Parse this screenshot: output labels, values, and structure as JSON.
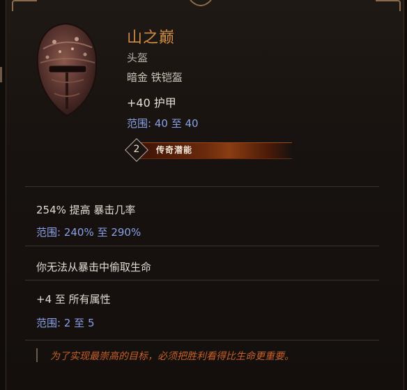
{
  "item": {
    "name": "山之巅",
    "type": "头盔",
    "rarity_type": "暗金 铁铠盔",
    "armor": "+40 护甲",
    "armor_range": {
      "label": "范围",
      "min": "40",
      "sep": "至",
      "max": "40"
    },
    "legendary_badge": {
      "rank": "2",
      "label": "传奇潜能"
    }
  },
  "affixes": [
    {
      "text": "254% 提高 暴击几率",
      "range": {
        "label": "范围",
        "min": "240%",
        "sep": "至",
        "max": "290%"
      }
    },
    {
      "text": "你无法从暴击中偷取生命"
    },
    {
      "text": "+4 至 所有属性",
      "range": {
        "label": "范围",
        "min": "2",
        "sep": "至",
        "max": "5"
      }
    }
  ],
  "flavor_text": "为了实现最崇高的目标，必须把胜利看得比生命更重要。",
  "colors": {
    "name": "#d08c44",
    "range": "#8aa0e8",
    "flavor": "#c7602a",
    "badge": "#8a3d12"
  },
  "icons": {
    "item_art": "iron-helm-icon",
    "badge_shape": "diamond"
  }
}
